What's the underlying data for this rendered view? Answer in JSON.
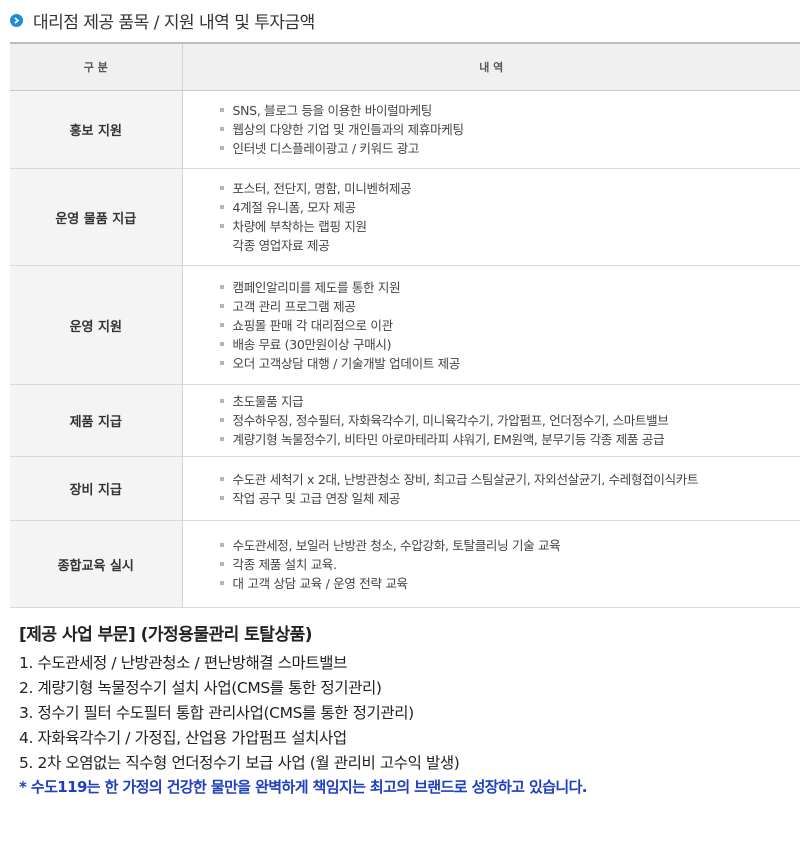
{
  "section": {
    "title": "대리점 제공 품목 / 지원 내역 및 투자금액"
  },
  "table": {
    "headers": [
      "구 분",
      "내 역"
    ],
    "rows": [
      {
        "category": "홍보 지원",
        "items": [
          "SNS, 블로그 등을 이용한 바이럴마케팅",
          "웹상의 다양한 기업 및 개인들과의 제휴마케팅",
          "인터넷 디스플레이광고 /  키워드 광고"
        ],
        "extra": ""
      },
      {
        "category": "운영 물품 지급",
        "items": [
          "포스터, 전단지, 명함, 미니벤허제공",
          "4계절 유니폼, 모자 제공",
          "차량에 부착하는 랩핑 지원"
        ],
        "extra": "각종 영업자료 제공"
      },
      {
        "category": "운영 지원",
        "items": [
          "캠페인알리미를 제도를 통한 지원",
          "고객 관리 프로그램 제공",
          "쇼핑몰 판매 각 대리점으로 이관",
          "배송 무료 (30만원이상 구매시)",
          "오더 고객상담 대행 / 기술개발 업데이트 제공"
        ],
        "extra": ""
      },
      {
        "category": "제품 지급",
        "items": [
          "초도물품 지급",
          "정수하우징, 정수필터, 자화육각수기, 미니육각수기, 가압펌프, 언더정수기, 스마트밸브",
          "계량기형 녹물정수기, 비타민 아로마테라피 샤워기, EM원액, 분무기등 각종 제품 공급"
        ],
        "extra": ""
      },
      {
        "category": "장비 지급",
        "items": [
          "수도관 세척기 x 2대, 난방관청소 장비, 최고급 스팀살균기, 자외선살균기, 수레형접이식카트",
          "작업 공구 및 고급 연장 일체 제공"
        ],
        "extra": ""
      },
      {
        "category": "종합교육 실시",
        "items": [
          "수도관세정, 보일러 난방관 청소, 수압강화, 토탈클리닝 기술 교육",
          "각종 제품 설치 교육.",
          "대 고객 상담 교육 /  운영 전략 교육"
        ],
        "extra": ""
      }
    ]
  },
  "business": {
    "title": "[제공 사업 부문] (가정용물관리 토탈상품)",
    "lines": [
      "1. 수도관세정 / 난방관청소 / 편난방해결 스마트밸브",
      "2. 계량기형 녹물정수기 설치 사업(CMS를 통한 정기관리)",
      "3. 정수기 필터 수도필터 통합 관리사업(CMS를 통한 정기관리)",
      "4. 자화육각수기 / 가정집, 산업용 가압펌프 설치사업",
      "5. 2차 오염없는 직수형 언더정수기 보급 사업 (월 관리비 고수익 발생)"
    ],
    "note": "* 수도119는 한 가정의 건강한 물만을 완벽하게 책임지는 최고의 브랜드로 성장하고 있습니다."
  },
  "colors": {
    "accent_bullet": "#1e8fd6",
    "note_text": "#1e3fbf",
    "header_bg": "#f0f0f0",
    "category_bg": "#f4f4f4"
  },
  "icons": {
    "heading_bullet": "chevron-right-circle-icon"
  }
}
